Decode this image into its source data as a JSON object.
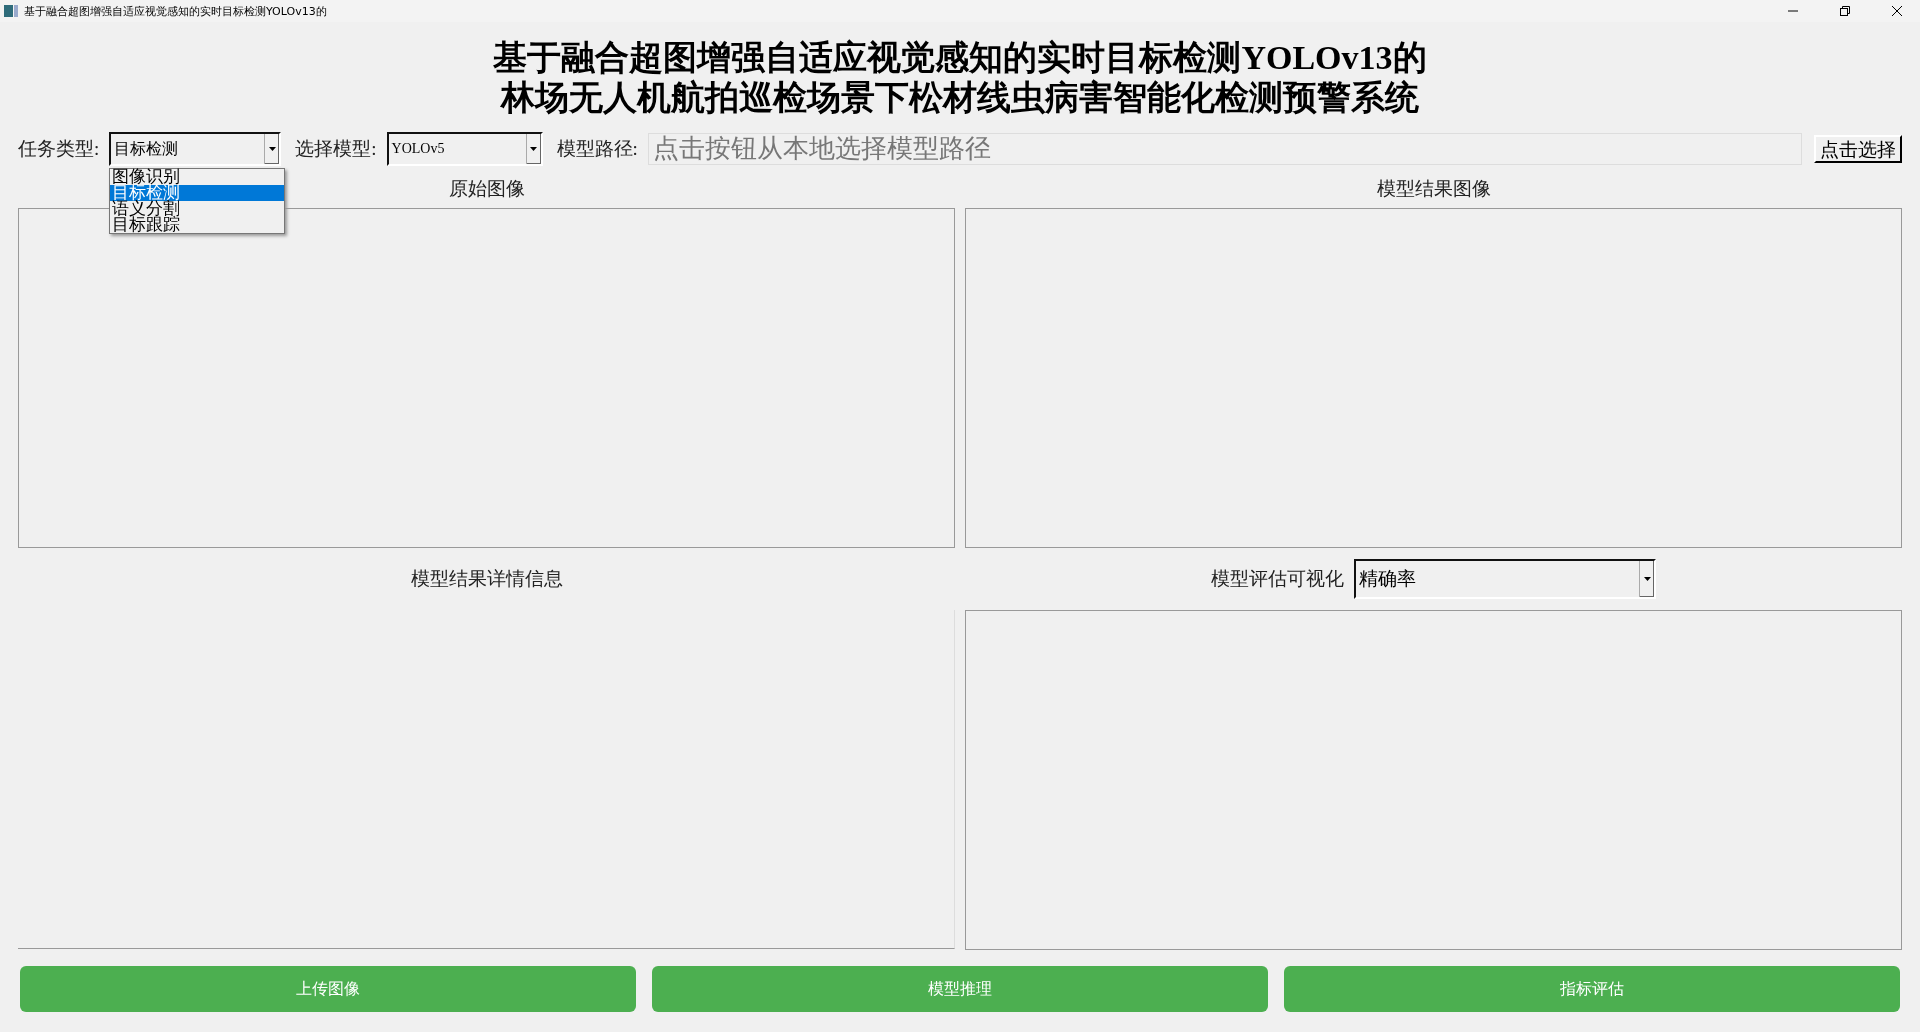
{
  "window": {
    "title": "基于融合超图增强自适应视觉感知的实时目标检测YOLOv13的"
  },
  "heading": [
    "基于融合超图增强自适应视觉感知的实时目标检测YOLOv13的",
    "林场无人机航拍巡检场景下松材线虫病害智能化检测预警系统"
  ],
  "task_type": {
    "label": "任务类型:",
    "value": "目标检测",
    "expanded": true,
    "options": [
      {
        "label": "图像识别",
        "selected": false
      },
      {
        "label": "目标检测",
        "selected": true
      },
      {
        "label": "语义分割",
        "selected": false
      },
      {
        "label": "目标跟踪",
        "selected": false
      }
    ]
  },
  "model_select": {
    "label": "选择模型:",
    "value": "YOLOv5"
  },
  "model_path": {
    "label": "模型路径:",
    "placeholder": "点击按钮从本地选择模型路径"
  },
  "choose_button": "点击选择",
  "panels": {
    "original": "原始图像",
    "result": "模型结果图像",
    "details": "模型结果详情信息"
  },
  "eval_vis": {
    "label": "模型评估可视化",
    "value": "精确率"
  },
  "buttons": [
    "上传图像",
    "模型推理",
    "指标评估"
  ]
}
